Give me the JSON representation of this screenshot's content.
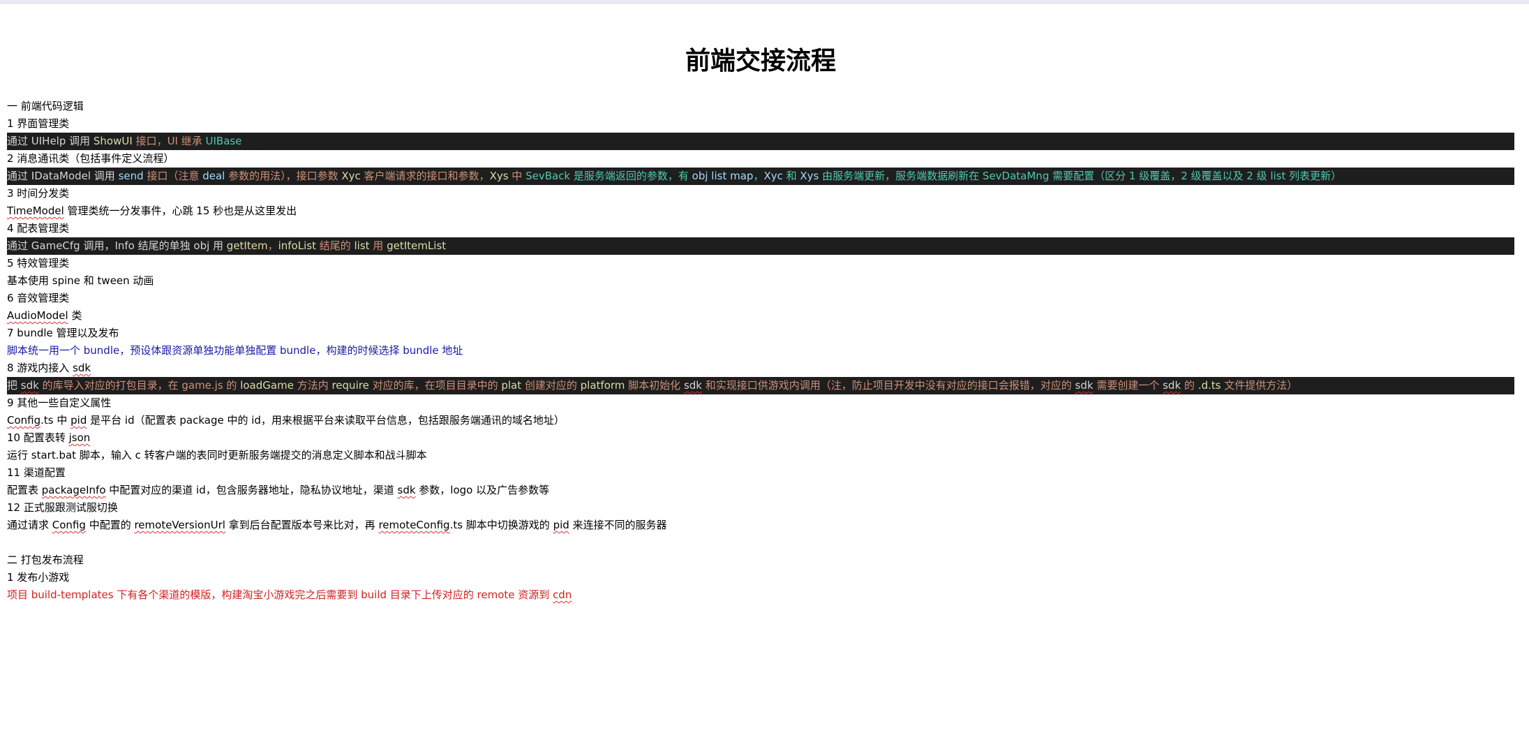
{
  "title": "前端交接流程",
  "s1": "一 前端代码逻辑",
  "s1_1": "1 界面管理类",
  "s1_1c": [
    "通过 UIHelp 调用 ",
    "ShowUI",
    " 接口，UI 继承 ",
    "UIBase"
  ],
  "s1_2": "2 消息通讯类（包括事件定义流程）",
  "s1_2c": [
    "通过 IDataModel 调用 ",
    "send",
    " 接口（注意 ",
    "deal",
    " 参数的用法），接口参数 ",
    "Xyc",
    " 客户端请求的接口和参数，",
    "Xys",
    " 中 ",
    "SevBack",
    " 是服务端返回的参数，有 ",
    "obj list map",
    "，",
    "Xyc",
    " 和 ",
    "Xys",
    " 由服务端更新，服务端数据刷新在 ",
    "SevDataMng",
    " 需要配置（区分 1 级覆盖，2 级覆盖以及 2 级 list 列表更新）"
  ],
  "s1_3": "3 时间分发类",
  "s1_3c": [
    "TimeModel",
    " 管理类统一分发事件，心跳 15 秒也是从这里发出"
  ],
  "s1_4": "4 配表管理类",
  "s1_4c": [
    "通过 GameCfg 调用，Info 结尾的单独 obj 用 ",
    "getItem",
    "，",
    "infoList",
    " 结尾的 ",
    "list",
    " 用 ",
    "getItemList"
  ],
  "s1_5": "5 特效管理类",
  "s1_5c": "基本使用 spine 和 tween 动画",
  "s1_6": "6 音效管理类",
  "s1_6c": [
    "AudioModel",
    " 类"
  ],
  "s1_7": "7 bundle 管理以及发布",
  "s1_7c": "脚本统一用一个 bundle，预设体跟资源单独功能单独配置 bundle，构建的时候选择 bundle 地址",
  "s1_8": [
    "8 游戏内接入 ",
    "sdk"
  ],
  "s1_8c": [
    "把 ",
    "sdk",
    " 的库导入对应的打包目录，在 game.js 的 ",
    "loadGame",
    " 方法内 ",
    "require",
    " 对应的库，在项目目录中的 ",
    "plat",
    " 创建对应的 ",
    "platform",
    " 脚本初始化 ",
    "sdk",
    " 和实现接口供游戏内调用（注，防止项目开发中没有对应的接口会报错，对应的 ",
    "sdk",
    " 需要创建一个 ",
    "sdk",
    " 的 ",
    ".d.ts",
    " 文件提供方法）"
  ],
  "s1_9": "9 其他一些自定义属性",
  "s1_9c": [
    "Config",
    ".ts 中 ",
    "pid",
    " 是平台 id（配置表 package 中的 id，用来根据平台来读取平台信息，包括跟服务端通讯的域名地址）"
  ],
  "s1_10": [
    "10 配置表转 ",
    "json"
  ],
  "s1_10c": "运行 start.bat 脚本，输入 c 转客户端的表同时更新服务端提交的消息定义脚本和战斗脚本",
  "s1_11": "11 渠道配置",
  "s1_11c": [
    "配置表 ",
    "packageInfo",
    " 中配置对应的渠道 id，包含服务器地址，隐私协议地址，渠道 ",
    "sdk",
    " 参数，logo 以及广告参数等"
  ],
  "s1_12": "12 正式服跟测试服切换",
  "s1_12c": [
    "通过请求 ",
    "Config",
    " 中配置的 ",
    "remoteVersionUrl",
    " 拿到后台配置版本号来比对，再 ",
    "remoteConfig",
    ".ts 脚本中切换游戏的 ",
    "pid",
    " 来连接不同的服务器"
  ],
  "s2": "二 打包发布流程",
  "s2_1": "1 发布小游戏",
  "s2_1c": [
    "项目 build-templates 下有各个渠道的模版，构建淘宝小游戏完之后需要到 build 目录下上传对应的 remote 资源到 ",
    "cdn"
  ]
}
